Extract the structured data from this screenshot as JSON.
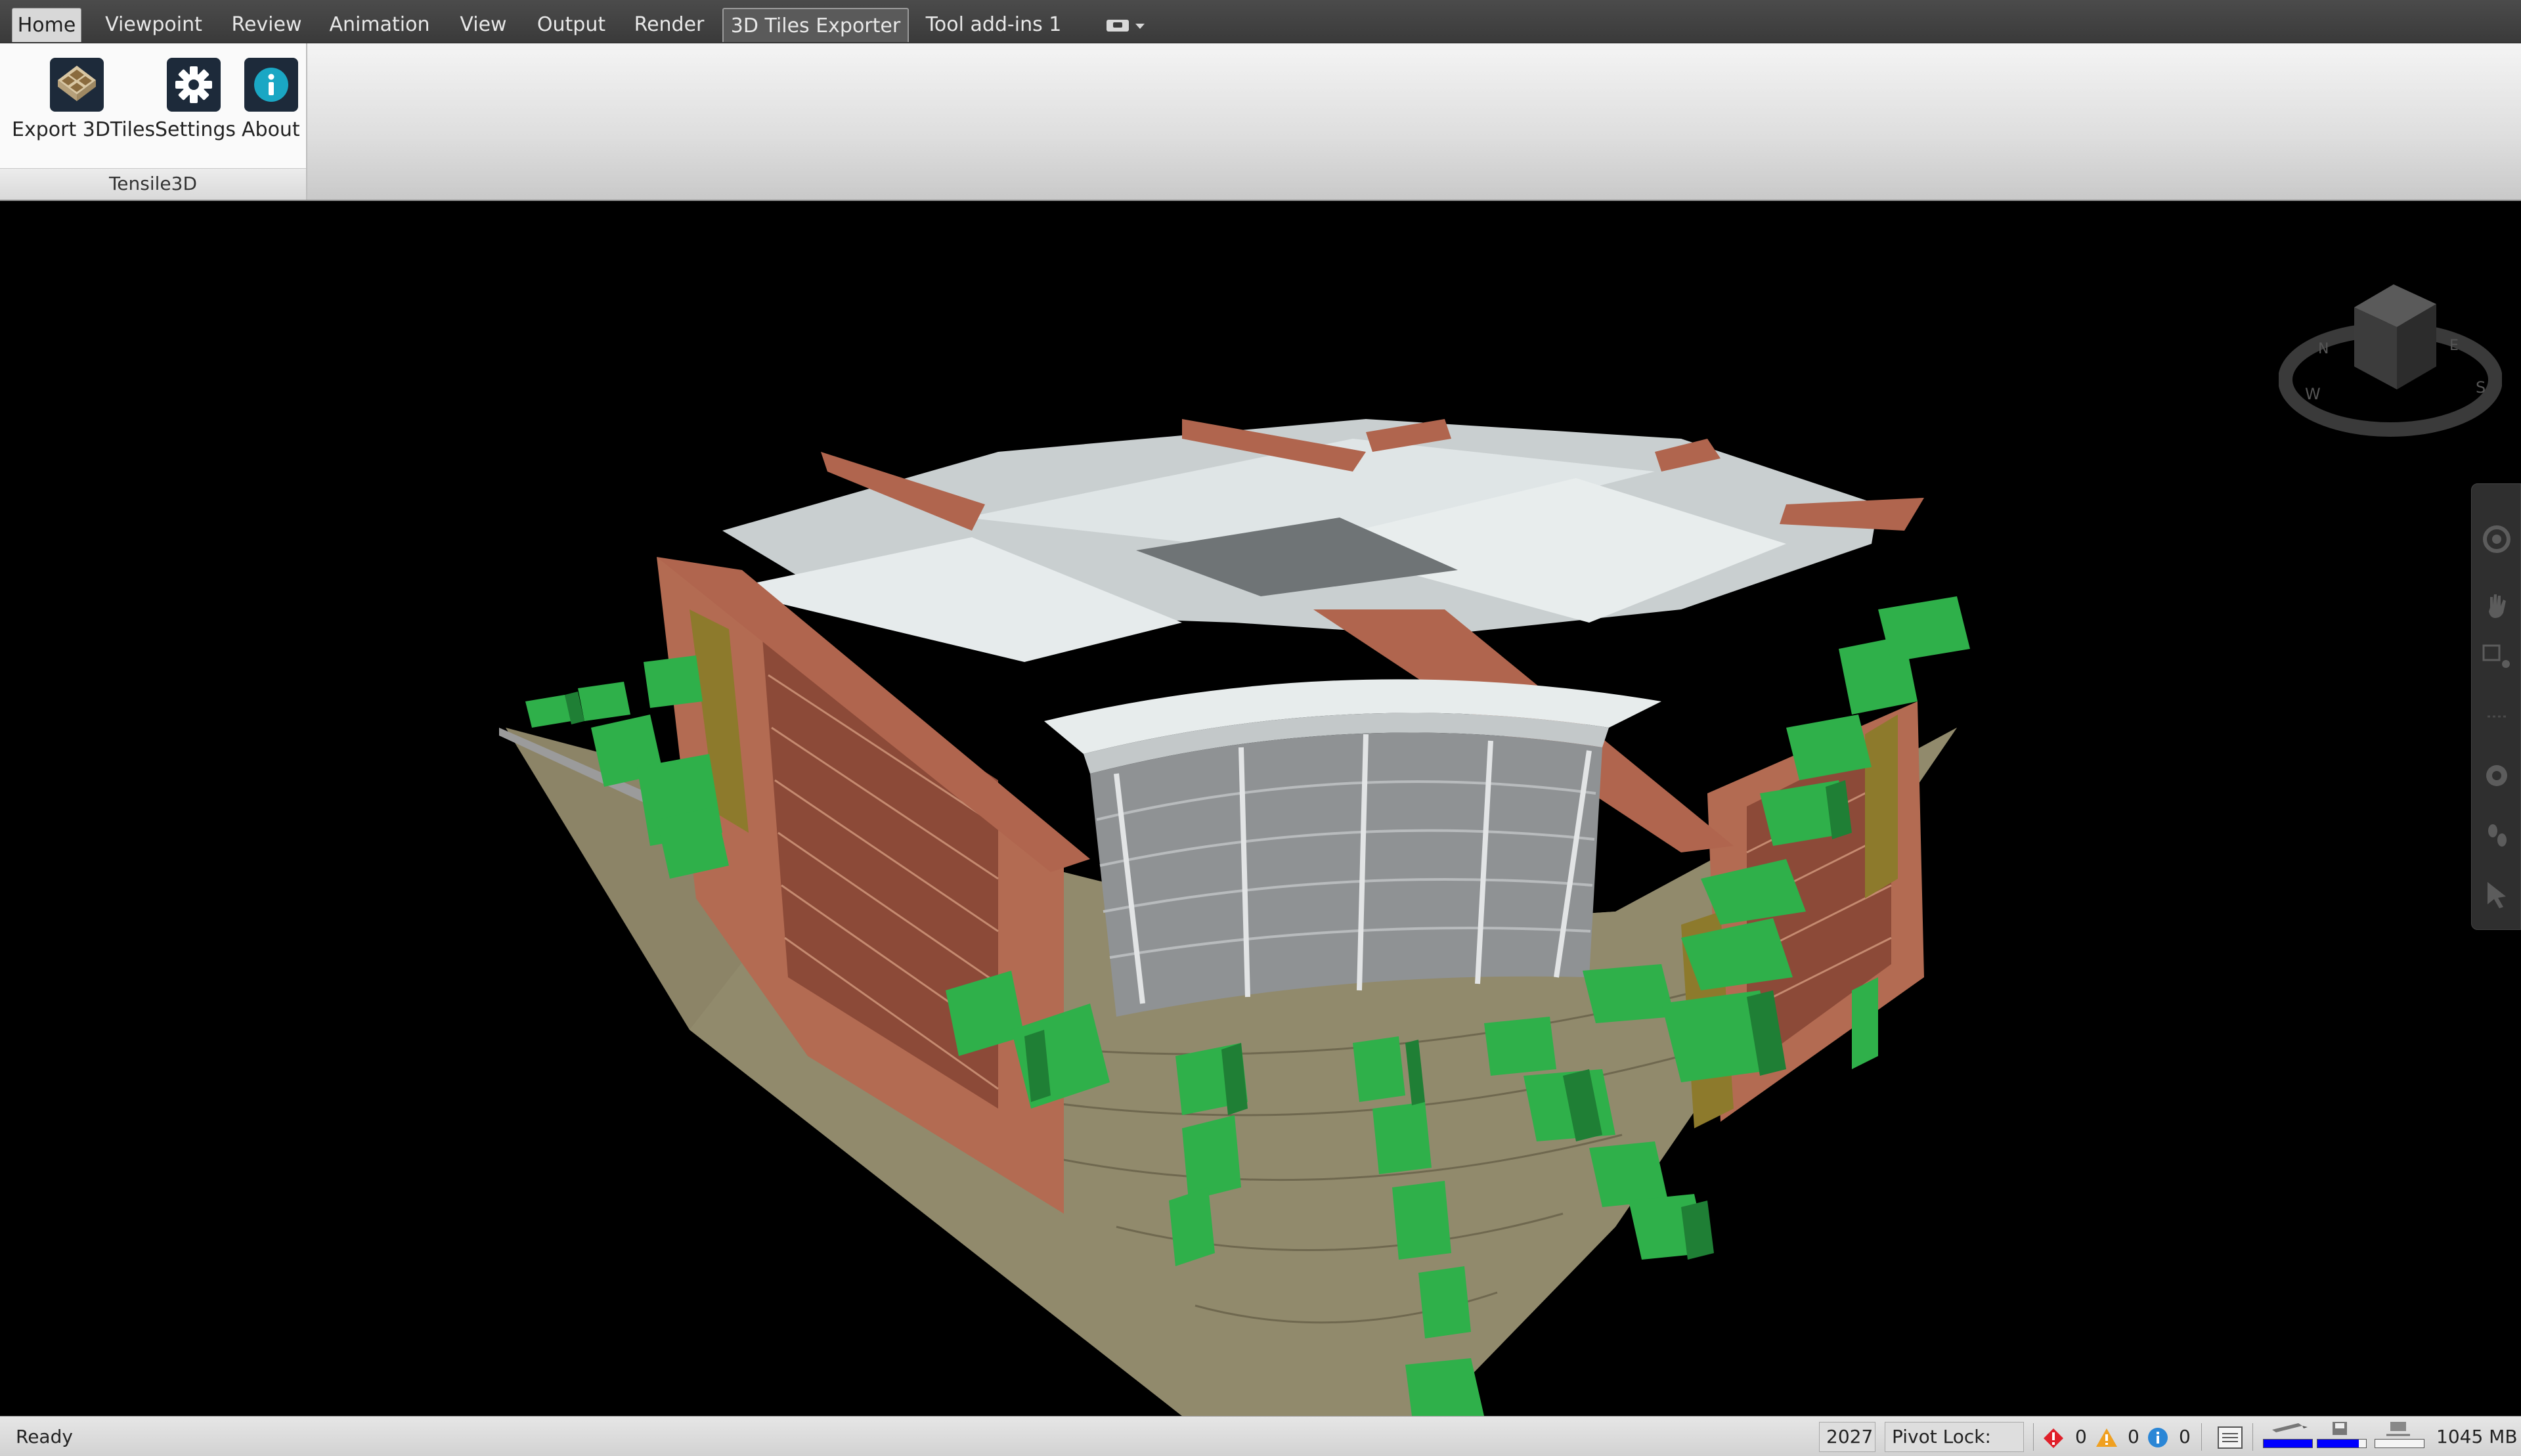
{
  "ribbon": {
    "tabs": [
      {
        "label": "Home"
      },
      {
        "label": "Viewpoint"
      },
      {
        "label": "Review"
      },
      {
        "label": "Animation"
      },
      {
        "label": "View"
      },
      {
        "label": "Output"
      },
      {
        "label": "Render"
      },
      {
        "label": "3D Tiles Exporter"
      },
      {
        "label": "Tool add-ins 1"
      }
    ],
    "panel": {
      "title": "Tensile3D",
      "buttons": [
        {
          "label": "Export 3DTiles",
          "icon": "export-3dtiles-icon"
        },
        {
          "label": "Settings",
          "icon": "gear-icon"
        },
        {
          "label": "About",
          "icon": "info-icon"
        }
      ]
    }
  },
  "viewport": {
    "viewcube_icon": "viewcube-icon",
    "nav_tools": [
      {
        "icon": "steering-wheel-icon"
      },
      {
        "icon": "pan-hand-icon"
      },
      {
        "icon": "zoom-icon"
      },
      {
        "icon": "orbit-icon"
      },
      {
        "icon": "look-icon"
      },
      {
        "icon": "walk-icon"
      },
      {
        "icon": "select-arrow-icon"
      }
    ]
  },
  "statusbar": {
    "status": "Ready",
    "sheet_number": "2027",
    "pivot_lock": "Pivot Lock: Off",
    "errors": "0",
    "warnings": "0",
    "info": "0",
    "memory": "1045 MB",
    "progress_pencil": 1.0,
    "progress_disk": 0.85,
    "progress_web": 0.0
  },
  "colors": {
    "tab_bar": "#3f3f3f",
    "ribbon_bg": "#e4e4e4",
    "viewport_bg": "#000000",
    "progress_fill": "#0000ff",
    "error_red": "#e0202a",
    "warning_amber": "#f0a020",
    "info_blue": "#2a86d6"
  }
}
